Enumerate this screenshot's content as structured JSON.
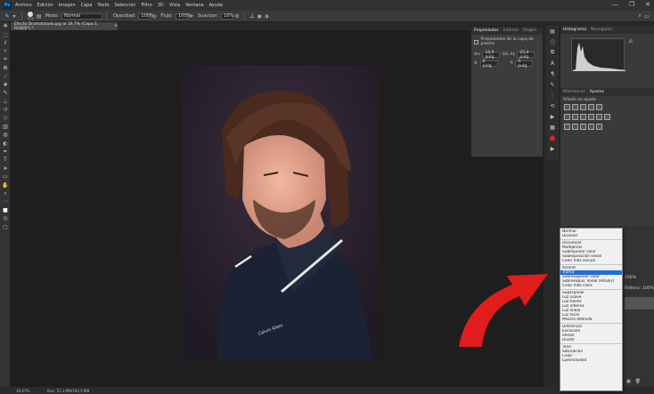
{
  "app": {
    "logo": "Ps"
  },
  "menu": [
    "Archivo",
    "Edición",
    "Imagen",
    "Capa",
    "Texto",
    "Selección",
    "Filtro",
    "3D",
    "Vista",
    "Ventana",
    "Ayuda"
  ],
  "window_controls": [
    "—",
    "❐",
    "✕"
  ],
  "options": {
    "brush_size": "572",
    "mode_label": "Modo:",
    "mode_value": "Normal",
    "opacity_label": "Opacidad:",
    "opacity_value": "100%",
    "flow_label": "Flujo:",
    "flow_value": "100%",
    "smooth_label": "Suavizar:",
    "smooth_value": "10%"
  },
  "document": {
    "tab_title": "Efecto Dramatizado.jpg al 16,7% (Capa 1, RGB/8*) *",
    "close": "×",
    "shirt_brand": "Calvin Klein"
  },
  "status": {
    "zoom": "16,67%",
    "doc": "Doc: 51,3 MB/102,5 MB"
  },
  "properties": {
    "tabs": [
      "Propiedades",
      "Informe",
      "Origen"
    ],
    "header": "Propiedades de la capa de píxeles",
    "an_label": "An:",
    "an_value": "16,6 pulg.",
    "go_label": "GO",
    "al_label": "Al:",
    "al_value": "25,4 pulg.",
    "x_label": "X:",
    "x_value": "0 pulg.",
    "y_label": "Y:",
    "y_value": "0 pulg."
  },
  "histogram": {
    "tabs": [
      "Histograma",
      "Navegador"
    ]
  },
  "adjustments": {
    "tabs": [
      "Bibliotecas",
      "Ajustes"
    ],
    "add_label": "Añadir un ajuste"
  },
  "layers_partial": {
    "opacity_value": "100%",
    "fill_label": "Relleno:",
    "fill_value": "100%"
  },
  "blend_menu": {
    "groups": [
      [
        "Normal",
        "Disolver"
      ],
      [
        "Oscurecer",
        "Multiplicar",
        "Subexponer color",
        "Subexposición lineal",
        "Color más oscuro"
      ],
      [
        "Aclarar",
        "Trama",
        "Sobreexponer color",
        "Sobreexpos. lineal (Añadir)",
        "Color más claro"
      ],
      [
        "Superponer",
        "Luz suave",
        "Luz fuerte",
        "Luz intensa",
        "Luz lineal",
        "Luz focal",
        "Mezcla definida"
      ],
      [
        "Diferencia",
        "Exclusión",
        "Restar",
        "Dividir"
      ],
      [
        "Tono",
        "Saturación",
        "Color",
        "Luminosidad"
      ]
    ],
    "selected": "Trama"
  },
  "colors": {
    "arrow": "#e01c1c",
    "highlight": "#1e6fd9"
  }
}
